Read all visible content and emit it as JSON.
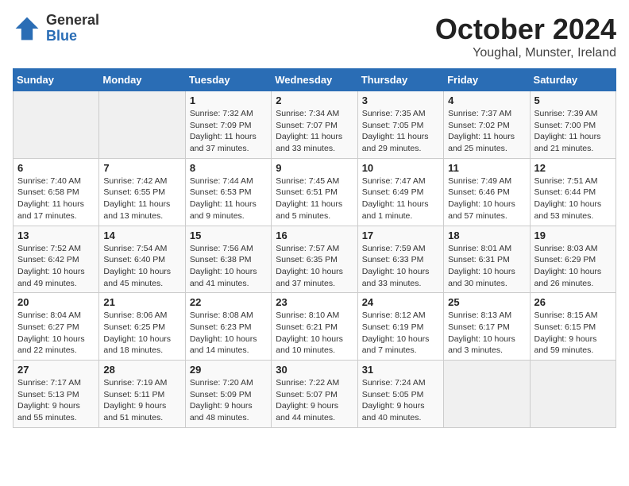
{
  "header": {
    "logo_general": "General",
    "logo_blue": "Blue",
    "month_title": "October 2024",
    "location": "Youghal, Munster, Ireland"
  },
  "weekdays": [
    "Sunday",
    "Monday",
    "Tuesday",
    "Wednesday",
    "Thursday",
    "Friday",
    "Saturday"
  ],
  "weeks": [
    [
      {
        "day": "",
        "sunrise": "",
        "sunset": "",
        "daylight": ""
      },
      {
        "day": "",
        "sunrise": "",
        "sunset": "",
        "daylight": ""
      },
      {
        "day": "1",
        "sunrise": "Sunrise: 7:32 AM",
        "sunset": "Sunset: 7:09 PM",
        "daylight": "Daylight: 11 hours and 37 minutes."
      },
      {
        "day": "2",
        "sunrise": "Sunrise: 7:34 AM",
        "sunset": "Sunset: 7:07 PM",
        "daylight": "Daylight: 11 hours and 33 minutes."
      },
      {
        "day": "3",
        "sunrise": "Sunrise: 7:35 AM",
        "sunset": "Sunset: 7:05 PM",
        "daylight": "Daylight: 11 hours and 29 minutes."
      },
      {
        "day": "4",
        "sunrise": "Sunrise: 7:37 AM",
        "sunset": "Sunset: 7:02 PM",
        "daylight": "Daylight: 11 hours and 25 minutes."
      },
      {
        "day": "5",
        "sunrise": "Sunrise: 7:39 AM",
        "sunset": "Sunset: 7:00 PM",
        "daylight": "Daylight: 11 hours and 21 minutes."
      }
    ],
    [
      {
        "day": "6",
        "sunrise": "Sunrise: 7:40 AM",
        "sunset": "Sunset: 6:58 PM",
        "daylight": "Daylight: 11 hours and 17 minutes."
      },
      {
        "day": "7",
        "sunrise": "Sunrise: 7:42 AM",
        "sunset": "Sunset: 6:55 PM",
        "daylight": "Daylight: 11 hours and 13 minutes."
      },
      {
        "day": "8",
        "sunrise": "Sunrise: 7:44 AM",
        "sunset": "Sunset: 6:53 PM",
        "daylight": "Daylight: 11 hours and 9 minutes."
      },
      {
        "day": "9",
        "sunrise": "Sunrise: 7:45 AM",
        "sunset": "Sunset: 6:51 PM",
        "daylight": "Daylight: 11 hours and 5 minutes."
      },
      {
        "day": "10",
        "sunrise": "Sunrise: 7:47 AM",
        "sunset": "Sunset: 6:49 PM",
        "daylight": "Daylight: 11 hours and 1 minute."
      },
      {
        "day": "11",
        "sunrise": "Sunrise: 7:49 AM",
        "sunset": "Sunset: 6:46 PM",
        "daylight": "Daylight: 10 hours and 57 minutes."
      },
      {
        "day": "12",
        "sunrise": "Sunrise: 7:51 AM",
        "sunset": "Sunset: 6:44 PM",
        "daylight": "Daylight: 10 hours and 53 minutes."
      }
    ],
    [
      {
        "day": "13",
        "sunrise": "Sunrise: 7:52 AM",
        "sunset": "Sunset: 6:42 PM",
        "daylight": "Daylight: 10 hours and 49 minutes."
      },
      {
        "day": "14",
        "sunrise": "Sunrise: 7:54 AM",
        "sunset": "Sunset: 6:40 PM",
        "daylight": "Daylight: 10 hours and 45 minutes."
      },
      {
        "day": "15",
        "sunrise": "Sunrise: 7:56 AM",
        "sunset": "Sunset: 6:38 PM",
        "daylight": "Daylight: 10 hours and 41 minutes."
      },
      {
        "day": "16",
        "sunrise": "Sunrise: 7:57 AM",
        "sunset": "Sunset: 6:35 PM",
        "daylight": "Daylight: 10 hours and 37 minutes."
      },
      {
        "day": "17",
        "sunrise": "Sunrise: 7:59 AM",
        "sunset": "Sunset: 6:33 PM",
        "daylight": "Daylight: 10 hours and 33 minutes."
      },
      {
        "day": "18",
        "sunrise": "Sunrise: 8:01 AM",
        "sunset": "Sunset: 6:31 PM",
        "daylight": "Daylight: 10 hours and 30 minutes."
      },
      {
        "day": "19",
        "sunrise": "Sunrise: 8:03 AM",
        "sunset": "Sunset: 6:29 PM",
        "daylight": "Daylight: 10 hours and 26 minutes."
      }
    ],
    [
      {
        "day": "20",
        "sunrise": "Sunrise: 8:04 AM",
        "sunset": "Sunset: 6:27 PM",
        "daylight": "Daylight: 10 hours and 22 minutes."
      },
      {
        "day": "21",
        "sunrise": "Sunrise: 8:06 AM",
        "sunset": "Sunset: 6:25 PM",
        "daylight": "Daylight: 10 hours and 18 minutes."
      },
      {
        "day": "22",
        "sunrise": "Sunrise: 8:08 AM",
        "sunset": "Sunset: 6:23 PM",
        "daylight": "Daylight: 10 hours and 14 minutes."
      },
      {
        "day": "23",
        "sunrise": "Sunrise: 8:10 AM",
        "sunset": "Sunset: 6:21 PM",
        "daylight": "Daylight: 10 hours and 10 minutes."
      },
      {
        "day": "24",
        "sunrise": "Sunrise: 8:12 AM",
        "sunset": "Sunset: 6:19 PM",
        "daylight": "Daylight: 10 hours and 7 minutes."
      },
      {
        "day": "25",
        "sunrise": "Sunrise: 8:13 AM",
        "sunset": "Sunset: 6:17 PM",
        "daylight": "Daylight: 10 hours and 3 minutes."
      },
      {
        "day": "26",
        "sunrise": "Sunrise: 8:15 AM",
        "sunset": "Sunset: 6:15 PM",
        "daylight": "Daylight: 9 hours and 59 minutes."
      }
    ],
    [
      {
        "day": "27",
        "sunrise": "Sunrise: 7:17 AM",
        "sunset": "Sunset: 5:13 PM",
        "daylight": "Daylight: 9 hours and 55 minutes."
      },
      {
        "day": "28",
        "sunrise": "Sunrise: 7:19 AM",
        "sunset": "Sunset: 5:11 PM",
        "daylight": "Daylight: 9 hours and 51 minutes."
      },
      {
        "day": "29",
        "sunrise": "Sunrise: 7:20 AM",
        "sunset": "Sunset: 5:09 PM",
        "daylight": "Daylight: 9 hours and 48 minutes."
      },
      {
        "day": "30",
        "sunrise": "Sunrise: 7:22 AM",
        "sunset": "Sunset: 5:07 PM",
        "daylight": "Daylight: 9 hours and 44 minutes."
      },
      {
        "day": "31",
        "sunrise": "Sunrise: 7:24 AM",
        "sunset": "Sunset: 5:05 PM",
        "daylight": "Daylight: 9 hours and 40 minutes."
      },
      {
        "day": "",
        "sunrise": "",
        "sunset": "",
        "daylight": ""
      },
      {
        "day": "",
        "sunrise": "",
        "sunset": "",
        "daylight": ""
      }
    ]
  ]
}
